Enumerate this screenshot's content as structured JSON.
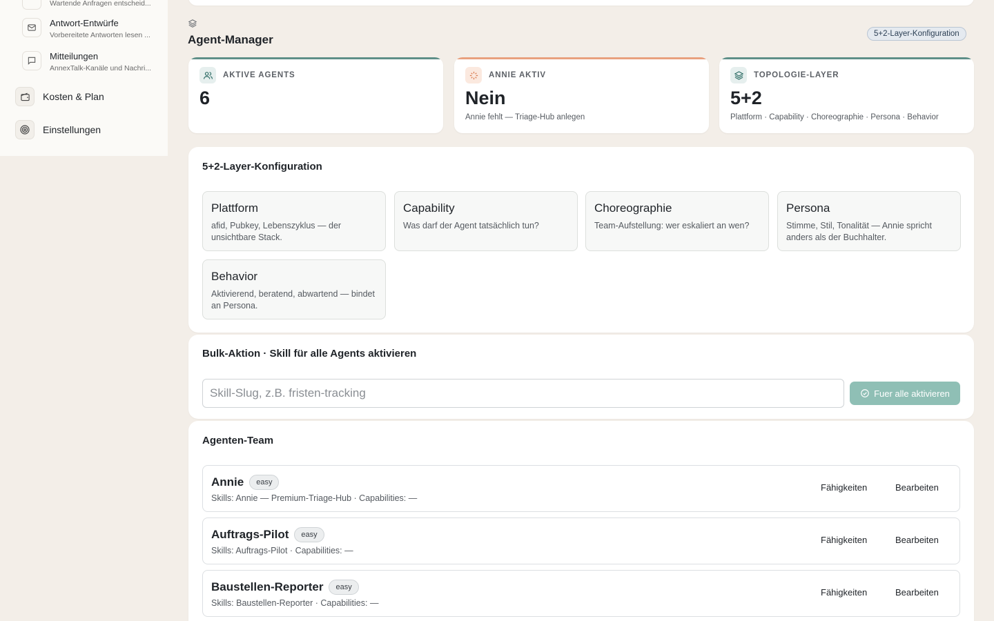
{
  "sidebar": {
    "partial_top_subtitle": "Wartende Anfragen entscheid...",
    "sub_items": [
      {
        "icon": "mail-icon",
        "title": "Antwort-Entwürfe",
        "subtitle": "Vorbereitete Antworten lesen ..."
      },
      {
        "icon": "message-icon",
        "title": "Mitteilungen",
        "subtitle": "AnnexTalk-Kanäle und Nachri..."
      }
    ],
    "main_items": [
      {
        "icon": "wallet-icon",
        "label": "Kosten & Plan"
      },
      {
        "icon": "target-icon",
        "label": "Einstellungen"
      }
    ]
  },
  "header": {
    "icon": "layers-icon",
    "title": "Agent-Manager",
    "badge": "5+2-Layer-Konfiguration"
  },
  "stats": [
    {
      "icon": "users-icon",
      "label": "AKTIVE AGENTS",
      "value": "6",
      "sub": "",
      "accent": "#5e8f88"
    },
    {
      "icon": "sparkle-icon",
      "label": "ANNIE AKTIV",
      "value": "Nein",
      "sub": "Annie fehlt — Triage-Hub anlegen",
      "accent": "#e8a07e"
    },
    {
      "icon": "layers-icon",
      "label": "TOPOLOGIE-LAYER",
      "value": "5+2",
      "sub": "Plattform · Capability · Choreographie · Persona · Behavior",
      "accent": "#5e8f88"
    }
  ],
  "layer_config": {
    "title": "5+2-Layer-Konfiguration",
    "layers": [
      {
        "title": "Plattform",
        "desc": "afid, Pubkey, Lebenszyklus — der unsichtbare Stack."
      },
      {
        "title": "Capability",
        "desc": "Was darf der Agent tatsächlich tun?"
      },
      {
        "title": "Choreographie",
        "desc": "Team-Aufstellung: wer eskaliert an wen?"
      },
      {
        "title": "Persona",
        "desc": "Stimme, Stil, Tonalität — Annie spricht anders als der Buchhalter."
      },
      {
        "title": "Behavior",
        "desc": "Aktivierend, beratend, abwartend — bindet an Persona."
      }
    ]
  },
  "bulk": {
    "title": "Bulk-Aktion · Skill für alle Agents aktivieren",
    "input_placeholder": "Skill-Slug, z.B. fristen-tracking",
    "input_value": "",
    "button_label": "Fuer alle aktivieren"
  },
  "team": {
    "title": "Agenten-Team",
    "skills_button": "Fähigkeiten",
    "edit_button": "Bearbeiten",
    "agents": [
      {
        "name": "Annie",
        "badge": "easy",
        "details": "Skills: Annie — Premium-Triage-Hub · Capabilities: —"
      },
      {
        "name": "Auftrags-Pilot",
        "badge": "easy",
        "details": "Skills: Auftrags-Pilot · Capabilities: —"
      },
      {
        "name": "Baustellen-Reporter",
        "badge": "easy",
        "details": "Skills: Baustellen-Reporter · Capabilities: —"
      }
    ]
  }
}
